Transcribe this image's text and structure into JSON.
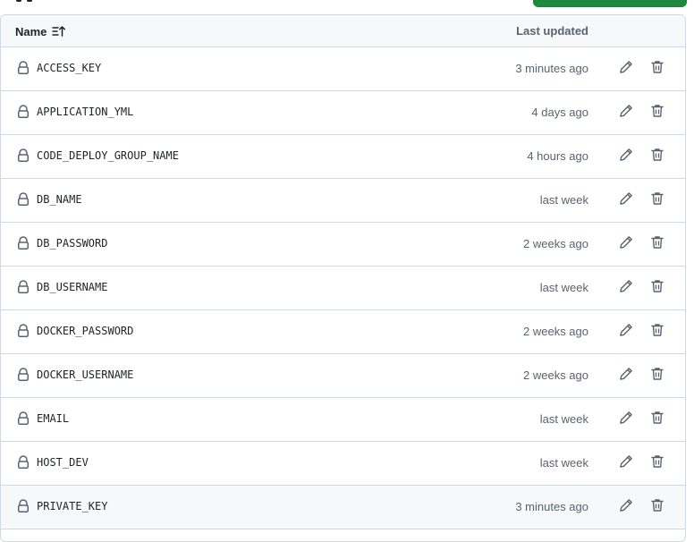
{
  "table": {
    "columns": {
      "name": "Name",
      "last_updated": "Last updated"
    },
    "rows": [
      {
        "name": "ACCESS_KEY",
        "updated": "3 minutes ago"
      },
      {
        "name": "APPLICATION_YML",
        "updated": "4 days ago"
      },
      {
        "name": "CODE_DEPLOY_GROUP_NAME",
        "updated": "4 hours ago"
      },
      {
        "name": "DB_NAME",
        "updated": "last week"
      },
      {
        "name": "DB_PASSWORD",
        "updated": "2 weeks ago"
      },
      {
        "name": "DB_USERNAME",
        "updated": "last week"
      },
      {
        "name": "DOCKER_PASSWORD",
        "updated": "2 weeks ago"
      },
      {
        "name": "DOCKER_USERNAME",
        "updated": "2 weeks ago"
      },
      {
        "name": "EMAIL",
        "updated": "last week"
      },
      {
        "name": "HOST_DEV",
        "updated": "last week"
      },
      {
        "name": "PRIVATE_KEY",
        "updated": "3 minutes ago"
      }
    ],
    "highlighted_row": 10
  },
  "icons": {
    "row_icon": "lock-icon",
    "edit": "pencil-icon",
    "delete": "trash-icon",
    "sort": "sort-ascending-icon"
  },
  "colors": {
    "primary_button": "#1f883d",
    "border": "#d1d9e0",
    "header_bg": "#f6f8fa",
    "muted_text": "#59636e"
  }
}
